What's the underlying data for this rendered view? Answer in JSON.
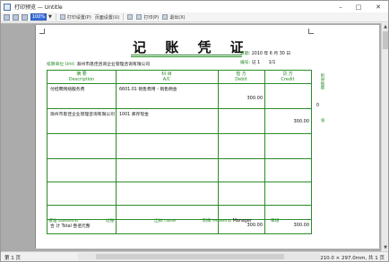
{
  "window": {
    "title": "打印预览 — Untitle",
    "controls": {
      "minimize": "–",
      "maximize": "□",
      "close": "✕"
    }
  },
  "toolbar": {
    "zoom": "100%",
    "print_settings": "打印设置(P)",
    "page_settings": "页面设置(U)",
    "print": "打印(P)",
    "exit": "退出(X)"
  },
  "voucher": {
    "title": "记 账 凭 证",
    "company_label": "核算单位",
    "company_label_en": "Unit:",
    "company": "滁州市思佳咨询企业管理咨询有限公司",
    "date_label": "日期:",
    "date": "2010 年 6 月 30 日",
    "number_label": "编号:",
    "number": "记 1",
    "page": "1/1",
    "headers": {
      "summary": "摘 要",
      "summary_en": "Description",
      "account": "科 目",
      "account_en": "A/C",
      "debit": "借 方",
      "debit_en": "Debit",
      "credit": "贷 方",
      "credit_en": "Credit"
    },
    "rows": [
      {
        "summary": "付招聘网络服务费",
        "account": "6601.01 销售费用 - 销售佣金",
        "debit": "300.00",
        "credit": ""
      },
      {
        "summary": "滁州市思佳企业管理咨询有限公司",
        "account": "1001 库存现金",
        "debit": "",
        "credit": "300.00"
      },
      {
        "summary": "",
        "account": "",
        "debit": "",
        "credit": ""
      },
      {
        "summary": "",
        "account": "",
        "debit": "",
        "credit": ""
      },
      {
        "summary": "",
        "account": "",
        "debit": "",
        "credit": ""
      }
    ],
    "total_label": "合 计 Total",
    "total_words": "叁佰元整",
    "total_debit": "300.00",
    "total_credit": "300.00",
    "attachment_label": "附单据数",
    "attachment_count": "0",
    "attachment_unit": "张",
    "footer": {
      "approved_label": "核准",
      "approved_en": "Approved by",
      "reviewed_label": "过账",
      "cashier_label": "出纳",
      "cashier_en": "Cashier",
      "prepared_label": "制单",
      "prepared_en": "Prepared by",
      "prepared_value": "Manager",
      "audit_label": "审核"
    }
  },
  "status": {
    "page": "第 1 页",
    "paper": "210.0 × 297.0mm, 共 1 页"
  }
}
